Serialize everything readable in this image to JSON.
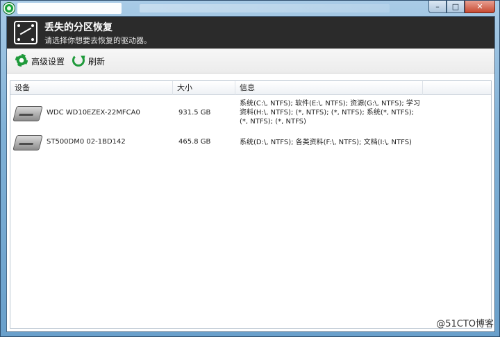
{
  "window": {
    "minimize_label": "–",
    "maximize_label": "□",
    "close_label": "✕"
  },
  "header": {
    "title": "丢失的分区恢复",
    "subtitle": "请选择你想要去恢复的驱动器。"
  },
  "toolbar": {
    "advanced_label": "高级设置",
    "refresh_label": "刷新"
  },
  "table": {
    "columns": [
      "设备",
      "大小",
      "信息"
    ],
    "rows": [
      {
        "device": "WDC  WD10EZEX-22MFCA0",
        "size": "931.5 GB",
        "info": "系统(C:\\, NTFS); 软件(E:\\, NTFS); 资源(G:\\, NTFS); 学习资料(H:\\, NTFS); (*, NTFS); (*, NTFS); 系统(*, NTFS); (*, NTFS); (*, NTFS)"
      },
      {
        "device": "ST500DM0 02-1BD142",
        "size": "465.8 GB",
        "info": "系统(D:\\, NTFS); 各类资料(F:\\, NTFS); 文档(I:\\, NTFS)"
      }
    ]
  },
  "watermark": "@51CTO博客",
  "colors": {
    "header_bg": "#2b2b2b",
    "accent_green": "#1f9a3b",
    "close_red": "#c74a32"
  }
}
